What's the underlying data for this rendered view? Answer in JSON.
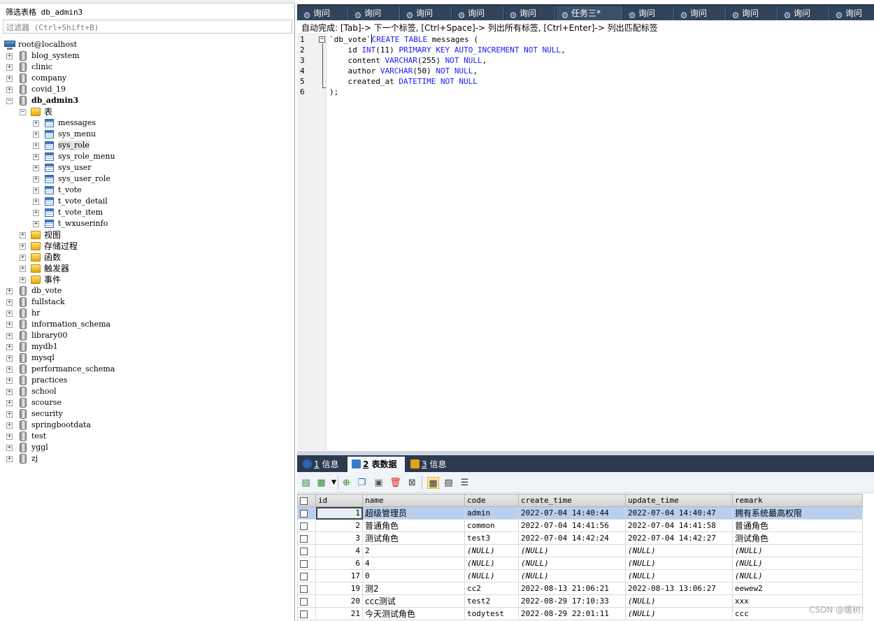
{
  "left_panel": {
    "filter_title": "筛选表格 db_admin3",
    "filter_placeholder": "过滤器 (Ctrl+Shift+B)",
    "server": "root@localhost",
    "databases_before": [
      "blog_system",
      "clinic",
      "company",
      "covid_19"
    ],
    "open_database": "db_admin3",
    "tables_folder": "表",
    "tables": [
      "messages",
      "sys_menu",
      "sys_role",
      "sys_role_menu",
      "sys_user",
      "sys_user_role",
      "t_vote",
      "t_vote_detail",
      "t_vote_item",
      "t_wxuserinfo"
    ],
    "other_folders": [
      "视图",
      "存储过程",
      "函数",
      "触发器",
      "事件"
    ],
    "databases_after": [
      "db_vote",
      "fullstack",
      "hr",
      "information_schema",
      "library00",
      "mydb1",
      "mysql",
      "performance_schema",
      "practices",
      "school",
      "scourse",
      "security",
      "springbootdata",
      "test",
      "yggl",
      "zj"
    ]
  },
  "query_tabs": [
    "询问",
    "询问",
    "询问",
    "询问",
    "询问",
    "任务三*",
    "询问",
    "询问",
    "询问",
    "询问",
    "询问"
  ],
  "hint": "自动完成: [Tab]-> 下一个标签, [Ctrl+Space]-> 列出所有标签, [Ctrl+Enter]-> 列出匹配标签",
  "editor": {
    "line_numbers": [
      "1",
      "2",
      "3",
      "4",
      "5",
      "6"
    ],
    "lines": [
      {
        "parts": [
          {
            "t": "`db_vote`"
          },
          {
            "cursor": true
          },
          {
            "t": "CREATE TABLE",
            "kw": true
          },
          {
            "t": " messages ("
          }
        ]
      },
      {
        "parts": [
          {
            "t": "    id "
          },
          {
            "t": "INT",
            "kw": true
          },
          {
            "t": "(11) "
          },
          {
            "t": "PRIMARY KEY AUTO_INCREMENT NOT NULL",
            "kw": true
          },
          {
            "t": ","
          }
        ]
      },
      {
        "parts": [
          {
            "t": "    content "
          },
          {
            "t": "VARCHAR",
            "kw": true
          },
          {
            "t": "(255) "
          },
          {
            "t": "NOT NULL",
            "kw": true
          },
          {
            "t": ","
          }
        ]
      },
      {
        "parts": [
          {
            "t": "    author "
          },
          {
            "t": "VARCHAR",
            "kw": true
          },
          {
            "t": "(50) "
          },
          {
            "t": "NOT NULL",
            "kw": true
          },
          {
            "t": ","
          }
        ]
      },
      {
        "parts": [
          {
            "t": "    created_at "
          },
          {
            "t": "DATETIME NOT NULL",
            "kw": true
          }
        ]
      },
      {
        "parts": [
          {
            "t": ");"
          }
        ]
      }
    ]
  },
  "result_tabs": [
    {
      "num": "1",
      "label": "信息",
      "active": false
    },
    {
      "num": "2",
      "label": "表数据",
      "active": true
    },
    {
      "num": "3",
      "label": "信息",
      "active": false
    }
  ],
  "grid": {
    "columns": [
      "id",
      "name",
      "code",
      "create_time",
      "update_time",
      "remark"
    ],
    "rows": [
      [
        "1",
        "超级管理员",
        "admin",
        "2022-07-04 14:40:44",
        "2022-07-04 14:40:47",
        "拥有系统最高权限"
      ],
      [
        "2",
        "普通角色",
        "common",
        "2022-07-04 14:41:56",
        "2022-07-04 14:41:58",
        "普通角色"
      ],
      [
        "3",
        "测试角色",
        "test3",
        "2022-07-04 14:42:24",
        "2022-07-04 14:42:27",
        "测试角色"
      ],
      [
        "4",
        "2",
        "(NULL)",
        "(NULL)",
        "(NULL)",
        "(NULL)"
      ],
      [
        "6",
        "4",
        "(NULL)",
        "(NULL)",
        "(NULL)",
        "(NULL)"
      ],
      [
        "17",
        "0",
        "(NULL)",
        "(NULL)",
        "(NULL)",
        "(NULL)"
      ],
      [
        "19",
        "测2",
        "cc2",
        "2022-08-13 21:06:21",
        "2022-08-13 13:06:27",
        "eewew2"
      ],
      [
        "20",
        "ccc测试",
        "test2",
        "2022-08-29 17:10:33",
        "(NULL)",
        "xxx"
      ],
      [
        "21",
        "今天测试角色",
        "todytest",
        "2022-08-29 22:01:11",
        "(NULL)",
        "ccc"
      ]
    ]
  },
  "watermark": "CSDN @暖树!"
}
